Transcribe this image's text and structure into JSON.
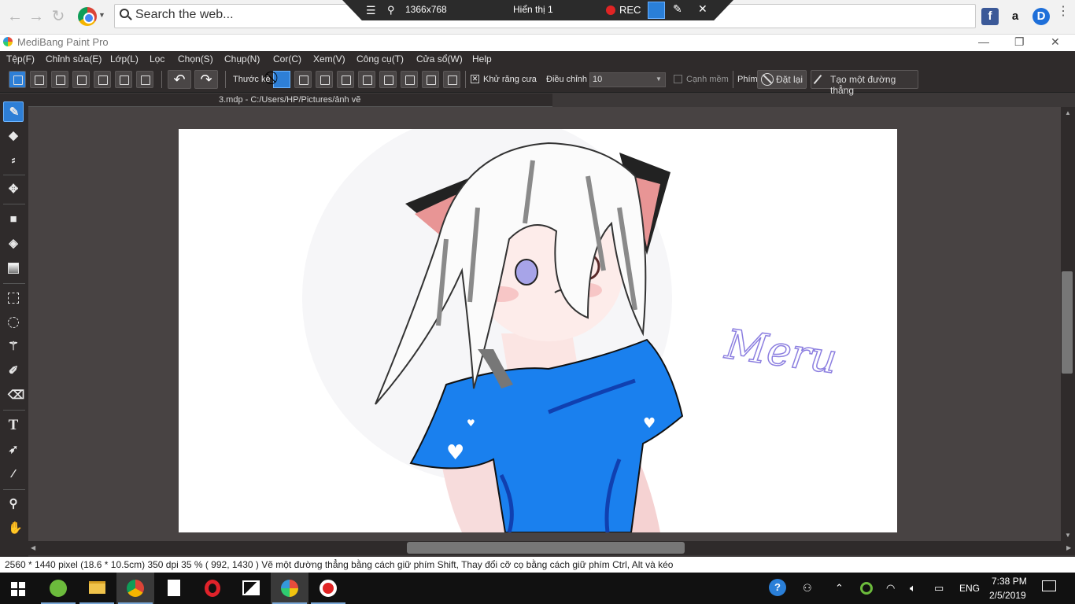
{
  "browser": {
    "search_placeholder": "Search the web...",
    "extensions": [
      "f",
      "a",
      "D"
    ]
  },
  "recorder": {
    "resolution": "1366x768",
    "display": "Hiển thị 1",
    "rec": "REC"
  },
  "app": {
    "title": "MediBang Paint Pro",
    "menu": [
      "Tệp(F)",
      "Chỉnh sửa(E)",
      "Lớp(L)",
      "Lọc",
      "Chọn(S)",
      "Chụp(N)",
      "Cor(C)",
      "Xem(V)",
      "Công cụ(T)",
      "Cửa sổ(W)",
      "Help"
    ]
  },
  "toolbar": {
    "ruler_label": "Thước kẻ",
    "antialias_label": "Khử răng cưa",
    "adjust_label": "Điều chỉnh",
    "adjust_value": "10",
    "soft_edge_label": "Cạnh mềm",
    "key_label": "Phím",
    "reset_label": "Đặt lại",
    "line_label": "Tạo một đường thẳng"
  },
  "document": {
    "tab_title": "3.mdp - C:/Users/HP/Pictures/ảnh vẽ",
    "artwork_signature": "Meru"
  },
  "status": {
    "text": "2560 * 1440 pixel   (18.6 * 10.5cm)   350 dpi   35 %   ( 992, 1430 )   Vẽ một đường thẳng bằng cách giữ phím Shift, Thay đổi cỡ cọ bằng cách giữ phím Ctrl, Alt và kéo"
  },
  "taskbar": {
    "lang": "ENG",
    "time": "7:38 PM",
    "date": "2/5/2019"
  },
  "colors": {
    "accent": "#2e7fd6",
    "app_bg": "#2f2b2b",
    "shirt": "#1a80ee"
  }
}
